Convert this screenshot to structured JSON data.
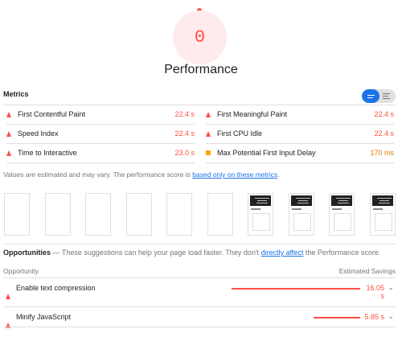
{
  "gauge": {
    "score": "0",
    "title": "Performance"
  },
  "metrics": {
    "title": "Metrics",
    "items": [
      {
        "name": "First Contentful Paint",
        "value": "22.4 s",
        "status": "fail"
      },
      {
        "name": "First Meaningful Paint",
        "value": "22.4 s",
        "status": "fail"
      },
      {
        "name": "Speed Index",
        "value": "22.4 s",
        "status": "fail"
      },
      {
        "name": "First CPU Idle",
        "value": "22.4 s",
        "status": "fail"
      },
      {
        "name": "Time to Interactive",
        "value": "23.0 s",
        "status": "fail"
      },
      {
        "name": "Max Potential First Input Delay",
        "value": "170 ms",
        "status": "average"
      }
    ],
    "note_prefix": "Values are estimated and may vary. The performance score is ",
    "note_link": "based only on these metrics",
    "note_suffix": "."
  },
  "filmstrip": {
    "frames": [
      "blank",
      "blank",
      "blank",
      "blank",
      "blank",
      "blank",
      "loaded",
      "loaded",
      "loaded",
      "loaded"
    ]
  },
  "opportunities": {
    "title": "Opportunities",
    "desc_prefix": " — These suggestions can help your page load faster. They don't ",
    "desc_link": "directly affect",
    "desc_suffix": " the Performance score.",
    "col_opportunity": "Opportunity",
    "col_savings": "Estimated Savings",
    "items": [
      {
        "name": "Enable text compression",
        "savings_line1": "16.05",
        "savings_line2": "s",
        "savings_seconds": 16.05
      },
      {
        "name": "Minify JavaScript",
        "savings_line1": "5.85 s",
        "savings_line2": "",
        "savings_seconds": 5.85
      }
    ]
  },
  "colors": {
    "fail": "#ff4e42",
    "average": "#ffa400",
    "link": "#1a73e8"
  }
}
